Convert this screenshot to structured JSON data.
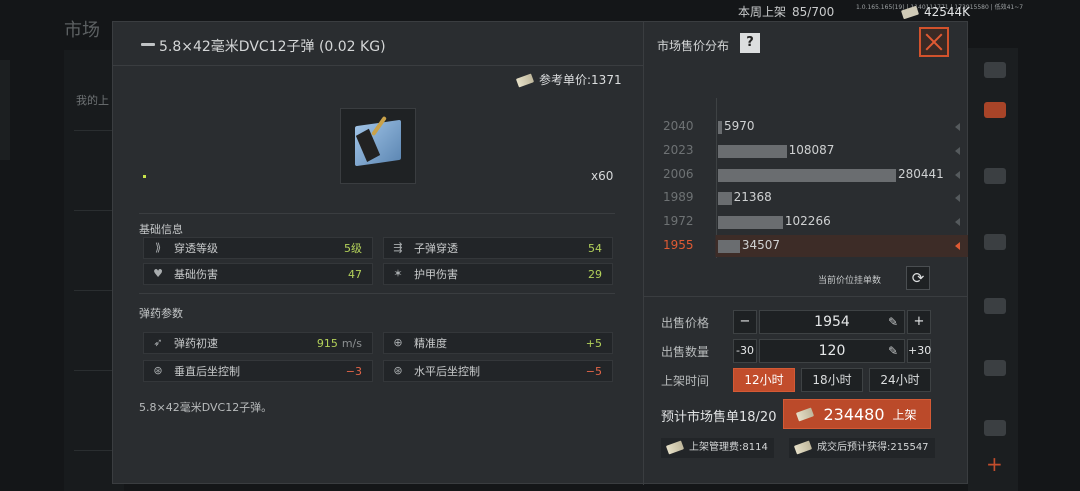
{
  "background": {
    "screen_title": "市场",
    "weekly_label": "本周上架",
    "weekly_value": "85/700",
    "debug_info": "1.0.165.165(19) | 1140111771 | 173915580 | 低效41~7",
    "money": "42544K",
    "my_listing_label": "我的上"
  },
  "item": {
    "title": "5.8×42毫米DVC12子弹 (0.02 KG)",
    "ref_price_label": "参考单价:",
    "ref_price_value": "1371",
    "quantity": "x60",
    "description": "5.8×42毫米DVC12子弹。",
    "icon": "ammo-box-icon"
  },
  "basic_info": {
    "title": "基础信息",
    "stats": [
      {
        "label": "穿透等级",
        "value": "5级",
        "icon": "penetration-icon"
      },
      {
        "label": "子弹穿透",
        "value": "54",
        "icon": "bullet-pierce-icon"
      },
      {
        "label": "基础伤害",
        "value": "47",
        "icon": "broken-heart-icon"
      },
      {
        "label": "护甲伤害",
        "value": "29",
        "icon": "armor-damage-icon"
      }
    ]
  },
  "ammo_params": {
    "title": "弹药参数",
    "stats": [
      {
        "label": "弹药初速",
        "value": "915",
        "unit": "m/s",
        "icon": "velocity-icon"
      },
      {
        "label": "精准度",
        "value": "+5",
        "icon": "crosshair-icon"
      },
      {
        "label": "垂直后坐控制",
        "value": "−3",
        "icon": "vertical-recoil-icon"
      },
      {
        "label": "水平后坐控制",
        "value": "−5",
        "icon": "horizontal-recoil-icon"
      }
    ]
  },
  "distribution": {
    "title": "市场售价分布",
    "help": "?",
    "current_price_label": "当前价位挂单数",
    "accent": "#e05a33"
  },
  "chart_data": {
    "type": "bar",
    "orientation": "horizontal",
    "categories": [
      "2040",
      "2023",
      "2006",
      "1989",
      "1972",
      "1955"
    ],
    "values": [
      5970,
      108087,
      280441,
      21368,
      102266,
      34507
    ],
    "selected": "1955",
    "title": "市场售价分布",
    "xlabel": "",
    "ylabel": ""
  },
  "sell_form": {
    "price_label": "出售价格",
    "price_value": "1954",
    "price_minus": "−",
    "price_plus": "+",
    "qty_label": "出售数量",
    "qty_value": "120",
    "qty_minus": "-30",
    "qty_plus": "+30",
    "time_label": "上架时间",
    "time_options": [
      "12小时",
      "18小时",
      "24小时"
    ],
    "time_selected": "12小时",
    "estimate_label": "预计市场售单18/20",
    "list_amount": "234480",
    "list_button": "上架",
    "fee_label": "上架管理费:",
    "fee_value": "8114",
    "income_label": "成交后预计获得:",
    "income_value": "215547"
  }
}
